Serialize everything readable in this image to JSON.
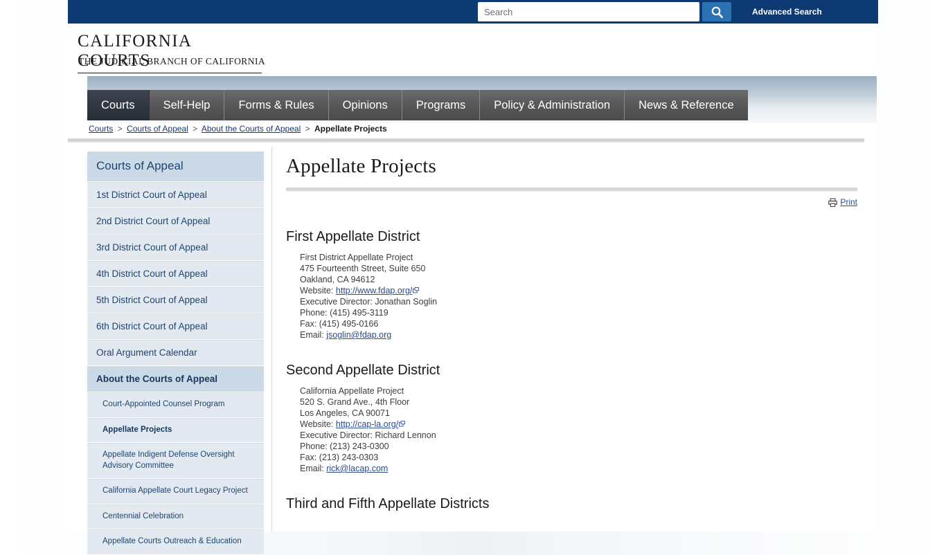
{
  "topbar": {
    "search": {
      "value": "",
      "placeholder": "Search",
      "icon": "search-icon"
    },
    "advanced_search_label": "Advanced Search",
    "background_color": "#0d3a72",
    "search_button_color": "#2b72b4"
  },
  "logo": {
    "main": "CALIFORNIA COURTS",
    "sub": "THE JUDICIAL BRANCH OF CALIFORNIA"
  },
  "nav": {
    "items": [
      {
        "label": "Courts",
        "active": true
      },
      {
        "label": "Self-Help",
        "active": false
      },
      {
        "label": "Forms & Rules",
        "active": false
      },
      {
        "label": "Opinions",
        "active": false
      },
      {
        "label": "Programs",
        "active": false
      },
      {
        "label": "Policy & Administration",
        "active": false
      },
      {
        "label": "News & Reference",
        "active": false
      }
    ]
  },
  "breadcrumb": {
    "items": [
      {
        "label": "Courts",
        "link": true
      },
      {
        "label": "Courts of Appeal",
        "link": true
      },
      {
        "label": "About the Courts of Appeal",
        "link": true
      },
      {
        "label": "Appellate Projects",
        "link": false
      }
    ],
    "separator": ">"
  },
  "sidebar": {
    "heading": "Courts of Appeal",
    "items": [
      {
        "label": "1st District Court of Appeal",
        "level": 1,
        "bold": false
      },
      {
        "label": "2nd District Court of Appeal",
        "level": 1,
        "bold": false
      },
      {
        "label": "3rd District Court of Appeal",
        "level": 1,
        "bold": false
      },
      {
        "label": "4th District Court of Appeal",
        "level": 1,
        "bold": false
      },
      {
        "label": "5th District Court of Appeal",
        "level": 1,
        "bold": false
      },
      {
        "label": "6th District Court of Appeal",
        "level": 1,
        "bold": false
      },
      {
        "label": "Oral Argument Calendar",
        "level": 1,
        "bold": false
      },
      {
        "label": "About the Courts of Appeal",
        "level": 1,
        "bold": true
      },
      {
        "label": "Court-Appointed Counsel Program",
        "level": 2,
        "bold": false
      },
      {
        "label": "Appellate Projects",
        "level": 2,
        "bold": true
      },
      {
        "label": "Appellate Indigent Defense Oversight Advisory Committee",
        "level": 2,
        "bold": false
      },
      {
        "label": "California Appellate Court Legacy Project",
        "level": 2,
        "bold": false
      },
      {
        "label": "Centennial Celebration",
        "level": 2,
        "bold": false
      },
      {
        "label": "Appellate Courts Outreach & Education",
        "level": 2,
        "bold": false
      }
    ]
  },
  "main": {
    "title": "Appellate Projects",
    "print_label": "Print",
    "print_icon": "printer-icon",
    "districts": [
      {
        "heading": "First Appellate District",
        "org": "First District Appellate Project",
        "street": "475 Fourteenth Street, Suite 650",
        "city": "Oakland, CA 94612",
        "website_label": "Website:",
        "website": "http://www.fdap.org/",
        "director_label": "Executive Director:",
        "director": "Jonathan Soglin",
        "phone_label": "Phone:",
        "phone": "(415) 495-3119",
        "fax_label": "Fax:",
        "fax": "(415) 495-0166",
        "email_label": "Email:",
        "email": "jsoglin@fdap.org"
      },
      {
        "heading": "Second Appellate District",
        "org": "California Appellate Project",
        "street": "520 S. Grand Ave., 4th Floor",
        "city": "Los Angeles, CA 90071",
        "website_label": "Website:",
        "website": "http://cap-la.org/",
        "director_label": "Executive Director:",
        "director": "Richard Lennon",
        "phone_label": "Phone:",
        "phone": "(213) 243-0300",
        "fax_label": "Fax:",
        "fax": "(213) 243-0303",
        "email_label": "Email:",
        "email": "rick@lacap.com"
      }
    ],
    "next_heading": "Third and Fifth Appellate Districts"
  }
}
